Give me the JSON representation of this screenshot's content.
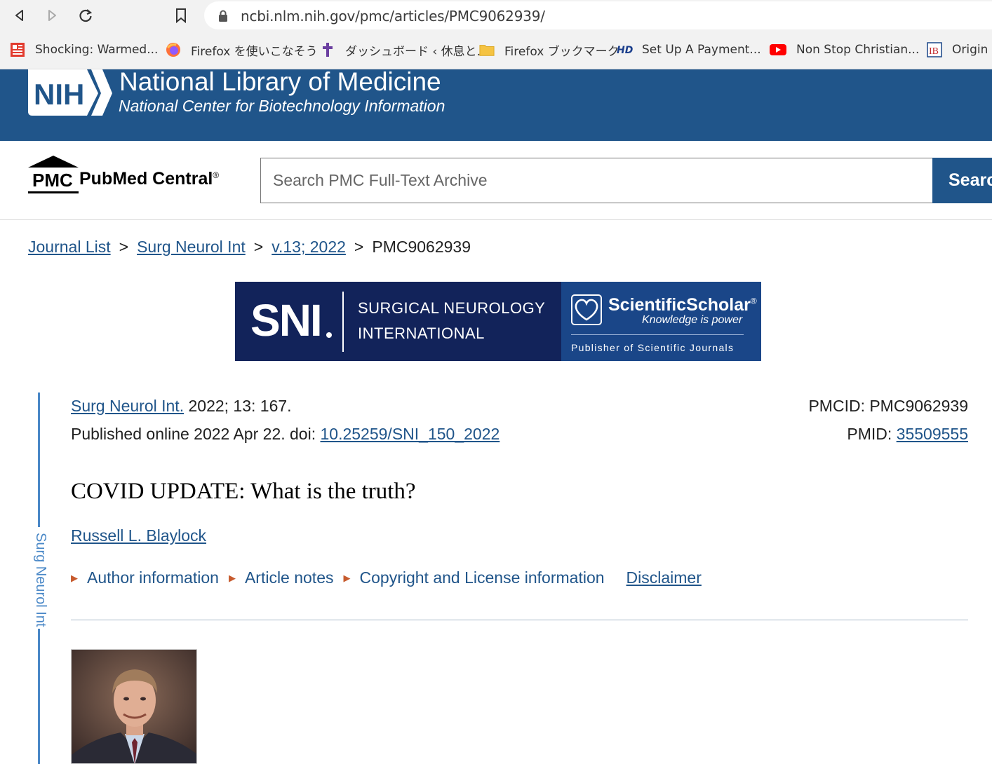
{
  "browser": {
    "url": "ncbi.nlm.nih.gov/pmc/articles/PMC9062939/",
    "bookmarks": [
      {
        "label": "Shocking: Warmed...",
        "icon": "news-icon"
      },
      {
        "label": "Firefox を使いこなそう",
        "icon": "firefox-icon"
      },
      {
        "label": "ダッシュボード ‹ 休息と...",
        "icon": "cross-icon"
      },
      {
        "label": "Firefox ブックマーク",
        "icon": "folder-icon"
      },
      {
        "label": "Set Up A Payment...",
        "icon": "hd-icon"
      },
      {
        "label": "Non Stop Christian...",
        "icon": "youtube-icon"
      },
      {
        "label": "Origin c",
        "icon": "ib-icon"
      }
    ]
  },
  "header": {
    "logo_text": "NIH",
    "title": "National Library of Medicine",
    "subtitle": "National Center for Biotechnology Information"
  },
  "pmc": {
    "logo_text": "PMC",
    "name": "PubMed Central",
    "reg": "®",
    "search_placeholder": "Search PMC Full-Text Archive",
    "search_button": "Search"
  },
  "breadcrumb": {
    "items": [
      "Journal List",
      "Surg Neurol Int",
      "v.13; 2022"
    ],
    "separator": ">",
    "current": "PMC9062939"
  },
  "journal_banner": {
    "abbrev": "SNI",
    "line1": "SURGICAL NEUROLOGY",
    "line2": "INTERNATIONAL",
    "publisher_name": "ScientificScholar",
    "publisher_reg": "®",
    "tagline": "Knowledge is power",
    "publisher_desc": "Publisher of Scientific Journals"
  },
  "article": {
    "side_label": "Surg Neurol Int",
    "journal_link": "Surg Neurol Int.",
    "citation": " 2022; 13: 167.",
    "published_prefix": "Published online 2022 Apr 22. doi: ",
    "doi": "10.25259/SNI_150_2022",
    "pmcid": "PMCID: PMC9062939",
    "pmid_label": "PMID: ",
    "pmid": "35509555",
    "title": "COVID UPDATE: What is the truth?",
    "author": "Russell L. Blaylock",
    "links": [
      "Author information",
      "Article notes",
      "Copyright and License information"
    ],
    "disclaimer": "Disclaimer"
  },
  "colors": {
    "nih_blue": "#20558a",
    "link_blue": "#20558a",
    "banner_navy": "#12235a",
    "arrow_orange": "#c75b2e"
  }
}
